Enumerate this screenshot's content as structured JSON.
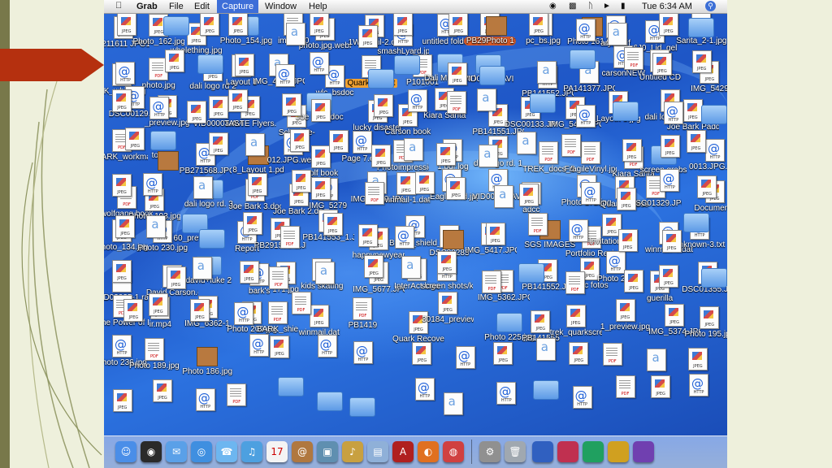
{
  "menubar": {
    "app": "Grab",
    "items": [
      "File",
      "Edit",
      "Capture",
      "Window",
      "Help"
    ],
    "clock": "Tue 6:34 AM"
  },
  "desktop_labels": [
    "1211611 JPG193169",
    "Photo_162.jpg",
    "wholething.jpg",
    "Photo_154.jpg",
    "image00",
    "photo.jpg.webloc",
    "1Winmail-2.dat",
    "smashLyard.jpg",
    "untitled folder",
    "PB29Photo 179.jpg",
    "pc_bs.jpg",
    "Photo 161.jpg",
    "arySf.gif",
    "6J0_Lid_gel",
    "Sarita_2-1.jpg",
    "RK_white.jpg",
    "photo.jpg",
    "dali logo rd 2",
    "Layout 1",
    "IMG_4831.JPG",
    "wlc_bsdoc",
    "Quark Export",
    "P101001",
    "Dali Museum Logo.jpg",
    "VID00004.AVI",
    "PB141552.JPG",
    "PA141377.JPG",
    "carsonNEW",
    "Untitled CD",
    "IMG_5429",
    "DSC00129.JPG",
    "_preview.jpg",
    "VID00003.AVI",
    "TASTE Flyers.doc",
    "Schedule-",
    "Joe Bark.doc",
    "lucky disaster",
    "Carson book",
    "Kiara Sarita",
    "PB141551.JPG",
    "DSC00133.JPG",
    "IMG_5485.JPG",
    "Layout 1.jpg",
    "dali logo rd. 3_Layout 1.pdf",
    "Joe Bark Paddleboard Essentials.pdf.webloc",
    "BARK_workmark 1.ai.webloc",
    "tortola",
    "PB271568.JPG",
    "8_Layout 1.pdf",
    "012.JPG.webloc",
    "wolf book",
    "Page 7.eps",
    "Photoimpression",
    "1.pdf log",
    "dali logo rd. 1",
    "TREK_docs_51552.pdf",
    "FragileVinyl.jpg",
    "Kiara Sarita",
    "screen grabs",
    "0013.JPG.webloc",
    "wolfgang book 2",
    "Photo_193.jpg",
    "dali logo rd. 3_layout 1_pdf.log",
    "Joe Bark 3.doc",
    "Joe Bark 2.doc",
    "IMG_5279",
    "IMG_6239.JPG",
    "winmail-1.dat",
    "_Eagle S4d.jpg",
    "VID00007.AVI",
    "adcc",
    "Photo 172.jpg",
    "QuarkXPress",
    "DSC01329.JPG",
    "Documents",
    "Photo_134.jpg",
    "Photo 230.jpg",
    "60_preview.",
    "Report",
    "PB291573-1.JPG",
    "PB141553_1.JPG",
    "happynewyearbw ra.jpg",
    "BARK_shield_1.ai",
    "DSC00283",
    "IMG_5417.JPG",
    "SGS IMAGES",
    "Portfolio Review",
    "Invitation.pdf",
    "winmail-4.dat",
    "unknown-3.txt",
    "VID00025-1.rar",
    "David Carson.doc",
    "david+luke 2",
    "bark's",
    "171.jpg",
    "kids skating",
    "IMG_5677.JPG",
    "InterAct logo",
    "screen shots/koehie",
    "IMG_5362.JPG",
    "PB141552.JPG",
    "misc fotos",
    "Photo 208",
    "guerilla",
    "DSC01355.JPG",
    "The Power of Less",
    "ir.mp4",
    "IMG_6362-1.",
    "Photo 209.jpg",
    "BARK_shie",
    "winmail.dat",
    "PB1419",
    "Quark Recovered",
    "30184_preview.jpg",
    "Photo 225.jpg",
    "PB141555",
    "trek_quarkscreen",
    "1_preview.jpg",
    "IMG_5374.JPG",
    "Photo 195.jpg",
    "Photo 236.jpg",
    "Photo 189.jpg",
    "Photo 186.jpg"
  ],
  "dock": {
    "items": [
      "Finder",
      "Dashboard",
      "Mail",
      "Safari",
      "iChat",
      "iTunes",
      "iCal",
      "Address Book",
      "iPhoto",
      "GarageBand",
      "Preview",
      "Adobe",
      "Firefox",
      "Photo Booth",
      "System Preferences",
      "Trash"
    ]
  }
}
